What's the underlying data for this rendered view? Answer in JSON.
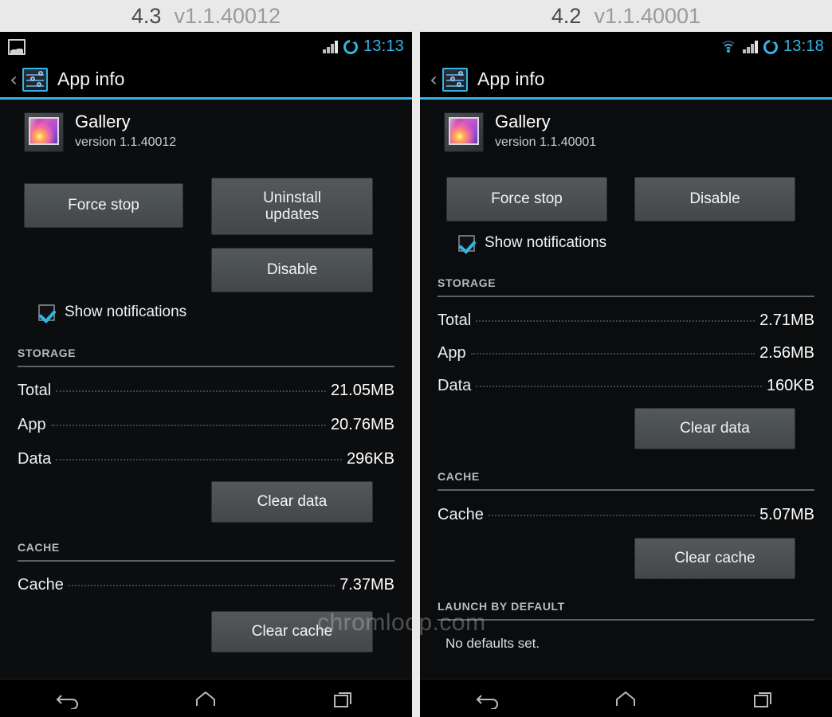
{
  "captions": [
    {
      "os_version": "4.3",
      "app_build": "v1.1.40012"
    },
    {
      "os_version": "4.2",
      "app_build": "v1.1.40001"
    }
  ],
  "watermark": "chromloop.com",
  "panels": [
    {
      "id": "android-4-3",
      "statusbar": {
        "notification_icon": "photo-icon",
        "has_wifi": false,
        "signal_icon": "signal-bars-icon",
        "sync_icon": "sync-circle-icon",
        "clock": "13:13"
      },
      "actionbar": {
        "back_glyph": "‹",
        "icon": "settings-sliders-icon",
        "title": "App info"
      },
      "app": {
        "icon": "gallery-app-icon",
        "name": "Gallery",
        "version": "version 1.1.40012"
      },
      "buttons": {
        "force_stop": "Force stop",
        "uninstall_updates": "Uninstall\nupdates",
        "disable": "Disable",
        "clear_data": "Clear data",
        "clear_cache": "Clear cache"
      },
      "checkbox": {
        "label": "Show notifications",
        "checked": true
      },
      "storage": {
        "header": "STORAGE",
        "rows": [
          {
            "key": "Total",
            "value": "21.05MB"
          },
          {
            "key": "App",
            "value": "20.76MB"
          },
          {
            "key": "Data",
            "value": "296KB"
          }
        ]
      },
      "cache": {
        "header": "CACHE",
        "rows": [
          {
            "key": "Cache",
            "value": "7.37MB"
          }
        ]
      },
      "launch_by_default": null,
      "navbar": {
        "back": "back-icon",
        "home": "home-icon",
        "recents": "recents-icon"
      }
    },
    {
      "id": "android-4-2",
      "statusbar": {
        "notification_icon": null,
        "has_wifi": true,
        "signal_icon": "signal-bars-icon",
        "sync_icon": "sync-circle-icon",
        "clock": "13:18"
      },
      "actionbar": {
        "back_glyph": "‹",
        "icon": "settings-sliders-icon",
        "title": "App info"
      },
      "app": {
        "icon": "gallery-app-icon",
        "name": "Gallery",
        "version": "version 1.1.40001"
      },
      "buttons": {
        "force_stop": "Force stop",
        "uninstall_updates": null,
        "disable": "Disable",
        "clear_data": "Clear data",
        "clear_cache": "Clear cache"
      },
      "checkbox": {
        "label": "Show notifications",
        "checked": true
      },
      "storage": {
        "header": "STORAGE",
        "rows": [
          {
            "key": "Total",
            "value": "2.71MB"
          },
          {
            "key": "App",
            "value": "2.56MB"
          },
          {
            "key": "Data",
            "value": "160KB"
          }
        ]
      },
      "cache": {
        "header": "CACHE",
        "rows": [
          {
            "key": "Cache",
            "value": "5.07MB"
          }
        ]
      },
      "launch_by_default": {
        "header": "LAUNCH BY DEFAULT",
        "text": "No defaults set."
      },
      "navbar": {
        "back": "back-icon",
        "home": "home-icon",
        "recents": "recents-icon"
      }
    }
  ],
  "colors": {
    "accent_blue": "#33b5e5",
    "panel_bg": "#0c0d0f",
    "button_bg": "#4a4e51",
    "page_bg": "#e9e9e9"
  }
}
